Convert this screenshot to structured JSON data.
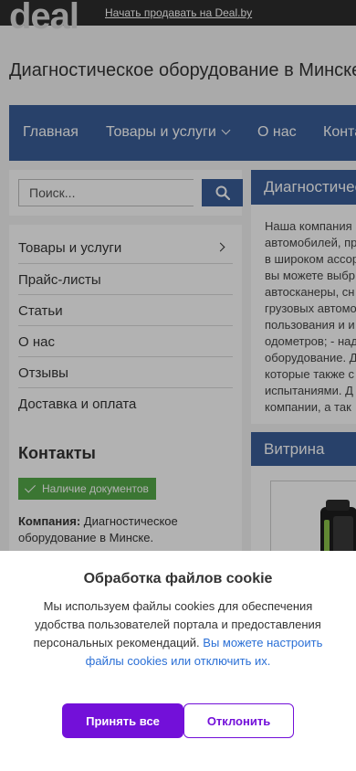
{
  "header": {
    "logo": "deal",
    "sell_link": "Начать продавать на Deal.by"
  },
  "site": {
    "title": "Диагностическое оборудование в Минске"
  },
  "nav": {
    "items": [
      {
        "label": "Главная"
      },
      {
        "label": "Товары и услуги",
        "icon": "chevron-down-icon"
      },
      {
        "label": "О нас"
      },
      {
        "label": "Конта"
      }
    ]
  },
  "search": {
    "placeholder": "Поиск...",
    "icon": "search-icon"
  },
  "sidebar": {
    "items": [
      {
        "label": "Товары и услуги",
        "icon": "chevron-right-icon"
      },
      {
        "label": "Прайс-листы"
      },
      {
        "label": "Статьи"
      },
      {
        "label": "О нас"
      },
      {
        "label": "Отзывы"
      },
      {
        "label": "Доставка и оплата"
      }
    ],
    "contacts_heading": "Контакты",
    "documents_badge": "Наличие документов",
    "company_label": "Компания:",
    "company_value": "Диагностическое оборудование в Минске."
  },
  "about": {
    "heading": "Диагностичес",
    "lines": [
      "Наша компания",
      "автомобилей, пр",
      "в широком ассор",
      "вы можете выбр",
      "автосканеры, сн",
      "грузовых автомо",
      "пользования и и",
      "одометров; - над",
      "оборудование. Д",
      "которые также с",
      "испытаниями. Д",
      "компании, а так"
    ]
  },
  "vitrina": {
    "heading": "Витрина"
  },
  "cookie": {
    "title": "Обработка файлов cookie",
    "text": "Мы используем файлы cookies для обеспечения удобства пользователей портала и предоставления персональных рекомендаций.",
    "link": "Вы можете настроить файлы cookies или отключить их.",
    "accept": "Принять все",
    "reject": "Отклонить"
  },
  "colors": {
    "brand_blue": "#3a5e98",
    "accept_purple": "#7310d9",
    "badge_green": "#55a94a",
    "link_blue": "#2a6fd6"
  }
}
